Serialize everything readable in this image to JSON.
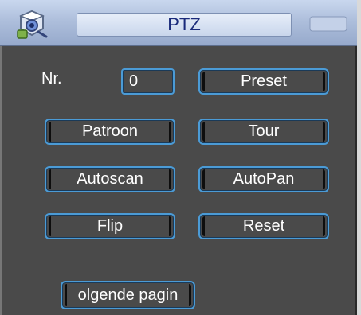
{
  "window": {
    "title": "PTZ"
  },
  "form": {
    "nr_label": "Nr.",
    "nr_value": "0"
  },
  "buttons": {
    "preset": "Preset",
    "patroon": "Patroon",
    "tour": "Tour",
    "autoscan": "Autoscan",
    "autopan": "AutoPan",
    "flip": "Flip",
    "reset": "Reset",
    "next_page": "olgende pagin"
  },
  "icons": {
    "app": "camera-ptz-icon"
  },
  "colors": {
    "title_text": "#1a2a7a",
    "panel_bg": "#4a4a4a",
    "button_border": "#4b9bd6",
    "text": "#ffffff"
  }
}
